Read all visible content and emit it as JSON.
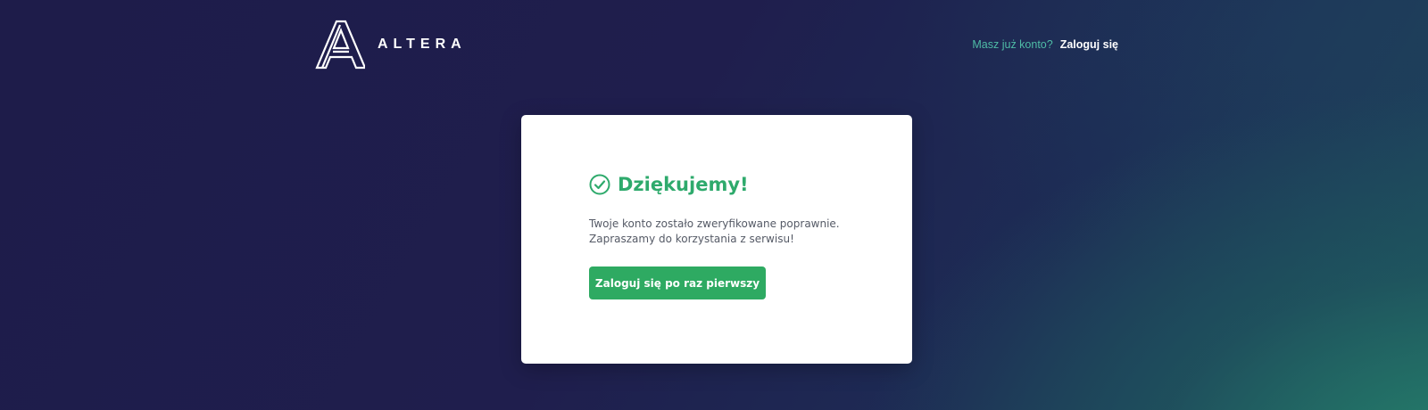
{
  "header": {
    "logo_text": "ALTERA",
    "auth_question": "Masz już konto?",
    "auth_login_link": "Zaloguj się"
  },
  "card": {
    "title": "Dziękujemy!",
    "message_line1": "Twoje konto zostało zweryfikowane poprawnie.",
    "message_line2": "Zapraszamy do korzystania z serwisu!",
    "cta_label": "Zaloguj się po raz pierwszy"
  },
  "colors": {
    "accent_green": "#2eaa62",
    "link_teal": "#4fbca6",
    "background_dark": "#1e1c4a"
  },
  "icons": {
    "logo": "altera-logo-icon",
    "title": "check-circle-icon"
  }
}
